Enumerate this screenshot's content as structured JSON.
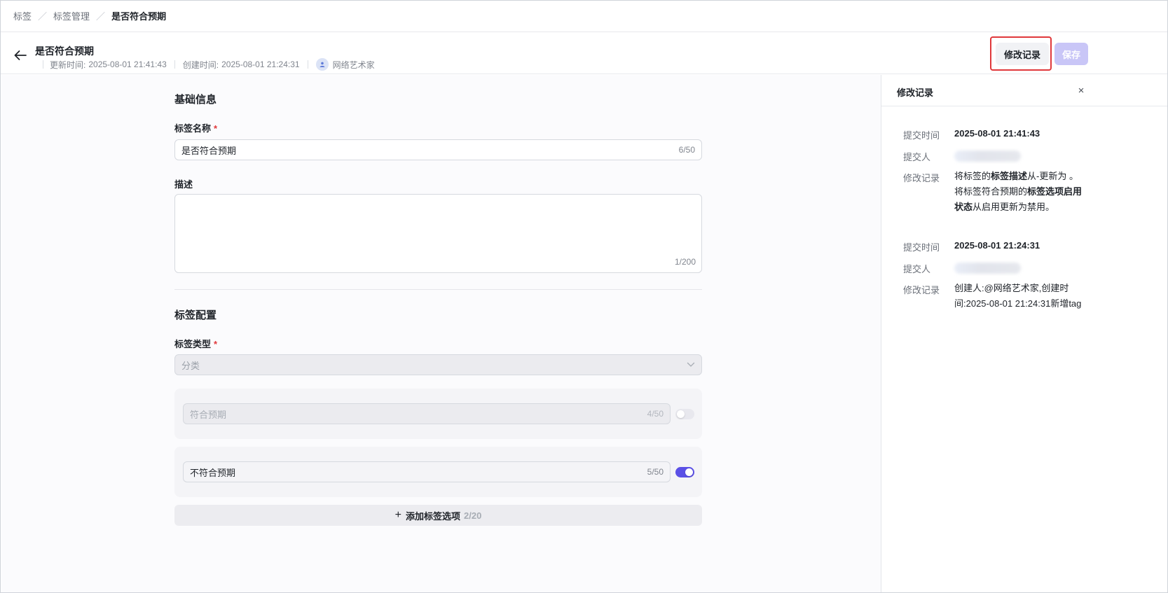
{
  "breadcrumb": [
    "标签",
    "标签管理",
    "是否符合预期"
  ],
  "header": {
    "title": "是否符合预期",
    "updated_label": "更新时间:",
    "updated_value": "2025-08-01 21:41:43",
    "created_label": "创建时间:",
    "created_value": "2025-08-01 21:24:31",
    "creator": "网络艺术家",
    "history_button": "修改记录",
    "save_button": "保存"
  },
  "form": {
    "basic_section": "基础信息",
    "name_label": "标签名称",
    "name_value": "是否符合预期",
    "name_count": "6/50",
    "desc_label": "描述",
    "desc_value": "",
    "desc_count": "1/200",
    "config_section": "标签配置",
    "type_label": "标签类型",
    "type_value": "分类",
    "required_mark": "*",
    "options": [
      {
        "value": "符合预期",
        "count": "4/50",
        "enabled": false
      },
      {
        "value": "不符合预期",
        "count": "5/50",
        "enabled": true
      }
    ],
    "add_option_label": "添加标签选项",
    "add_option_counter": "2/20"
  },
  "history_panel": {
    "title": "修改记录",
    "close": "×",
    "label_time": "提交时间",
    "label_submitter": "提交人",
    "label_record": "修改记录",
    "records": [
      {
        "time": "2025-08-01 21:41:43",
        "record_parts": [
          "将标签的",
          "标签描述",
          "从-更新为 。",
          "将标签符合预期的",
          "标签选项启用状态",
          "从启用更新为禁用。"
        ]
      },
      {
        "time": "2025-08-01 21:24:31",
        "record_text": "创建人:@网络艺术家,创建时间:2025-08-01 21:24:31新增tag"
      }
    ]
  },
  "colors": {
    "accent": "#5b50e6",
    "save_disabled": "#c9c6f7",
    "required": "#e0383b",
    "highlight": "#e0383b"
  }
}
